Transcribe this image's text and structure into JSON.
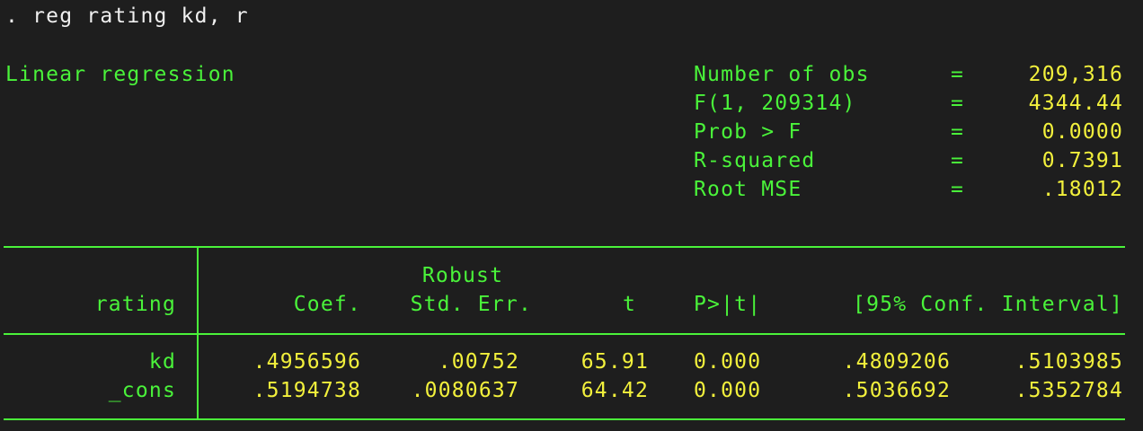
{
  "command": ". reg rating kd, r",
  "title": "Linear regression",
  "stats": [
    {
      "label": "Number of obs",
      "eq": "=",
      "value": "209,316"
    },
    {
      "label": "F(1, 209314)",
      "eq": "=",
      "value": "4344.44"
    },
    {
      "label": "Prob > F",
      "eq": "=",
      "value": "0.0000"
    },
    {
      "label": "R-squared",
      "eq": "=",
      "value": "0.7391"
    },
    {
      "label": "Root MSE",
      "eq": "=",
      "value": ".18012"
    }
  ],
  "table": {
    "depvar": "rating",
    "robust_label": "Robust",
    "headers": {
      "coef": "Coef.",
      "se": "Std. Err.",
      "t": "t",
      "p": "P>|t|",
      "ci": "[95% Conf. Interval]"
    },
    "rows": [
      {
        "var": "kd",
        "coef": ".4956596",
        "se": ".00752",
        "t": "65.91",
        "p": "0.000",
        "lo": ".4809206",
        "hi": ".5103985"
      },
      {
        "var": "_cons",
        "coef": ".5194738",
        "se": ".0080637",
        "t": "64.42",
        "p": "0.000",
        "lo": ".5036692",
        "hi": ".5352784"
      }
    ]
  },
  "colors": {
    "background": "#1e1e1e",
    "text": "#f0f0f0",
    "label": "#4af33a",
    "value": "#f2f03c"
  }
}
